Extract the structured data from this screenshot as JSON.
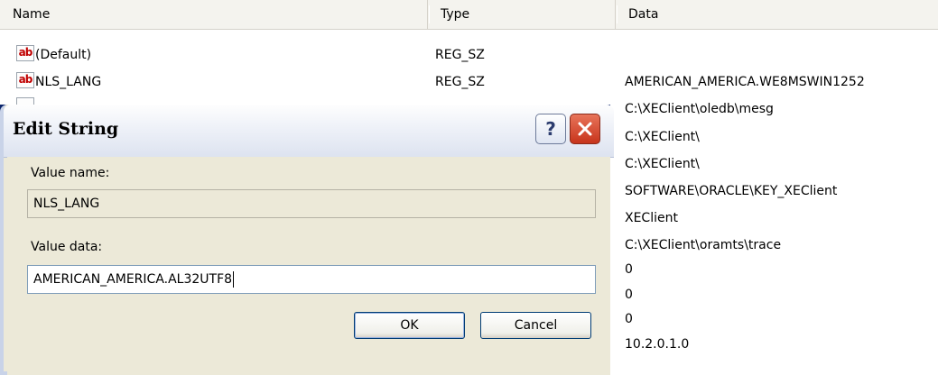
{
  "list": {
    "columns": {
      "name": "Name",
      "type": "Type",
      "data": "Data"
    },
    "icon": "string-value-icon",
    "icon_glyph": "ab",
    "rows": [
      {
        "name": "(Default)",
        "type": "REG_SZ",
        "data": ""
      },
      {
        "name": "NLS_LANG",
        "type": "REG_SZ",
        "data": "AMERICAN_AMERICA.WE8MSWIN1252"
      }
    ],
    "data_values": [
      "C:\\XEClient\\oledb\\mesg",
      "C:\\XEClient\\",
      "C:\\XEClient\\",
      "SOFTWARE\\ORACLE\\KEY_XEClient",
      "XEClient",
      "C:\\XEClient\\oramts\\trace",
      "0",
      "0",
      "0",
      "10.2.0.1.0"
    ]
  },
  "dialog": {
    "title": "Edit String",
    "help_glyph": "?",
    "value_name_label": "Value name:",
    "value_name": "NLS_LANG",
    "value_data_label": "Value data:",
    "value_data": "AMERICAN_AMERICA.AL32UTF8",
    "ok_label": "OK",
    "cancel_label": "Cancel"
  }
}
